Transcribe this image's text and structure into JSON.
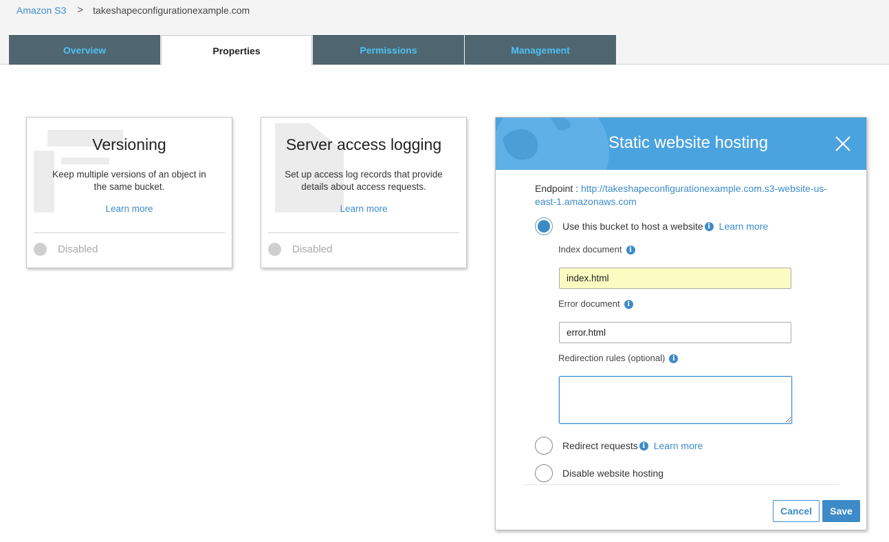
{
  "breadcrumb": {
    "root": "Amazon S3",
    "separator": ">",
    "current": "takeshapeconfigurationexample.com"
  },
  "tabs": [
    {
      "label": "Overview",
      "active": false
    },
    {
      "label": "Properties",
      "active": true
    },
    {
      "label": "Permissions",
      "active": false
    },
    {
      "label": "Management",
      "active": false
    }
  ],
  "cards": {
    "versioning": {
      "title": "Versioning",
      "description": "Keep multiple versions of an object in the same bucket.",
      "learn_more": "Learn more",
      "status": "Disabled"
    },
    "logging": {
      "title": "Server access logging",
      "description": "Set up access log records that provide details about access requests.",
      "learn_more": "Learn more",
      "status": "Disabled"
    }
  },
  "modal": {
    "title": "Static website hosting",
    "endpoint_label": "Endpoint : ",
    "endpoint_url": "http://takeshapeconfigurationexample.com.s3-website-us-east-1.amazonaws.com",
    "option_host": {
      "label": "Use this bucket to host a website",
      "learn_more": "Learn more",
      "selected": true
    },
    "index_document": {
      "label": "Index document",
      "value": "index.html"
    },
    "error_document": {
      "label": "Error document",
      "value": "error.html"
    },
    "redirection_rules": {
      "label": "Redirection rules (optional)",
      "value": ""
    },
    "option_redirect": {
      "label": "Redirect requests",
      "learn_more": "Learn more",
      "selected": false
    },
    "option_disable": {
      "label": "Disable website hosting",
      "selected": false
    },
    "cancel_label": "Cancel",
    "save_label": "Save"
  },
  "colors": {
    "accent": "#3d8bc9",
    "header": "#4aa3df",
    "tab_bg": "#4f6570",
    "tab_text": "#4fc1f2",
    "autofill": "#fafcc2"
  },
  "icons": {
    "info": "info-icon",
    "close": "close-icon",
    "disabled_status": "status-dot-icon"
  }
}
